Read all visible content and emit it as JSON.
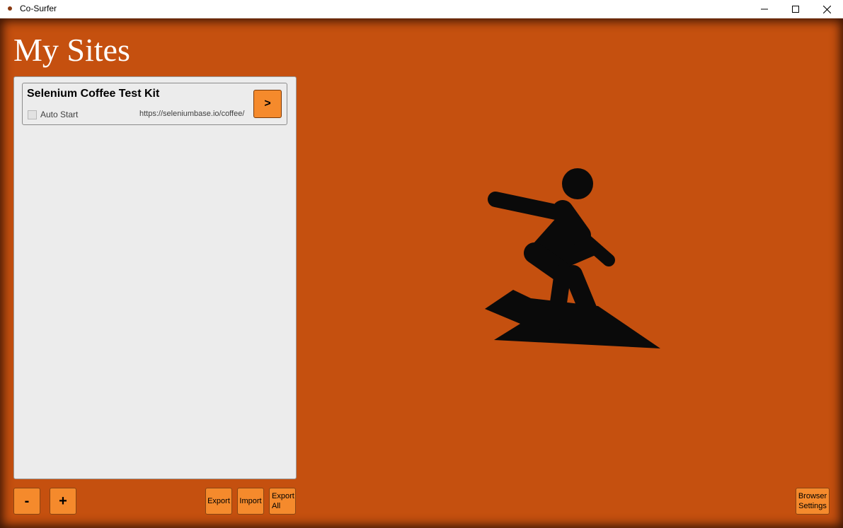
{
  "window": {
    "title": "Co-Surfer",
    "controls": [
      "minimize",
      "maximize",
      "close"
    ]
  },
  "main": {
    "page_title": "My Sites",
    "sites": [
      {
        "name": "Selenium Coffee Test Kit",
        "auto_start_label": "Auto Start",
        "auto_start_checked": false,
        "url": "https://seleniumbase.io/coffee/",
        "go_label": ">"
      }
    ],
    "buttons": {
      "remove": "-",
      "add": "+",
      "export": "Export",
      "import": "Import",
      "export_all": "Export All",
      "browser_settings": "Browser Settings"
    }
  },
  "colors": {
    "background": "#c5500f",
    "button": "#f58a2c",
    "panel": "#ececec"
  },
  "icons": [
    "surfer-logo"
  ]
}
